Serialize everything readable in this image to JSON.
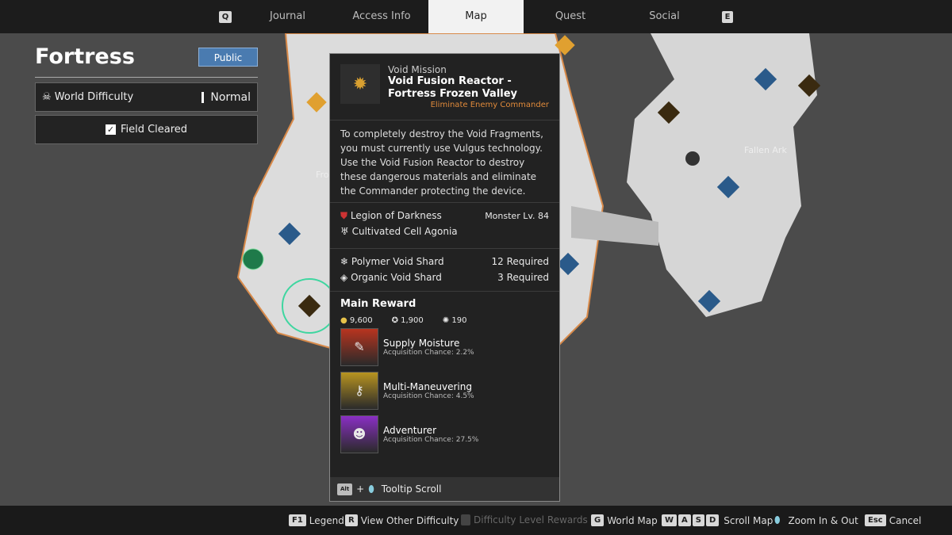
{
  "tabs": [
    {
      "key": "Q",
      "label": ""
    },
    {
      "label": "Journal"
    },
    {
      "label": "Access Info"
    },
    {
      "label": "Map",
      "active": true
    },
    {
      "label": "Quest"
    },
    {
      "label": "Social"
    },
    {
      "key": "E",
      "label": ""
    }
  ],
  "top_keys": {
    "left": "Q",
    "right": "E"
  },
  "page": {
    "title": "Fortress",
    "visibility": "Public"
  },
  "world_difficulty": {
    "label": "World Difficulty",
    "value": "Normal"
  },
  "field_cleared": {
    "label": "Field Cleared",
    "checked": true
  },
  "map_labels": {
    "fallen_ark": "Fallen Ark",
    "fro": "Fro"
  },
  "tooltip": {
    "category": "Void Mission",
    "title": "Void Fusion Reactor - Fortress Frozen Valley",
    "objective": "Eliminate Enemy Commander",
    "description": "To completely destroy the Void Fragments, you must currently use Vulgus technology. Use the Void Fusion Reactor to destroy these dangerous materials and eliminate the Commander protecting the device.",
    "faction": "Legion of Darkness",
    "monster_level": "Monster Lv. 84",
    "boss": "Cultivated Cell Agonia",
    "requirements": [
      {
        "name": "Polymer Void Shard",
        "count": "12 Required"
      },
      {
        "name": "Organic Void Shard",
        "count": "3 Required"
      }
    ],
    "main_reward_label": "Main Reward",
    "currencies": [
      {
        "icon": "gold-coin",
        "value": "9,600"
      },
      {
        "icon": "xp",
        "value": "1,900"
      },
      {
        "icon": "kuiper",
        "value": "190"
      }
    ],
    "rewards": [
      {
        "name": "Supply Moisture",
        "chance": "Acquisition Chance: 2.2%",
        "color": "#b8341f"
      },
      {
        "name": "Multi-Maneuvering",
        "chance": "Acquisition Chance: 4.5%",
        "color": "#b89420"
      },
      {
        "name": "Adventurer",
        "chance": "Acquisition Chance: 27.5%",
        "color": "#8a2fc4"
      }
    ],
    "scroll_hint": {
      "key": "Alt",
      "label": "Tooltip Scroll"
    }
  },
  "bottom": [
    {
      "key": "F1",
      "label": "Legend"
    },
    {
      "key": "R",
      "label": "View Other Difficulty"
    },
    {
      "key": "",
      "label": "Difficulty Level Rewards",
      "disabled": true
    },
    {
      "key": "G",
      "label": "World Map"
    },
    {
      "keys": [
        "W",
        "A",
        "S",
        "D"
      ],
      "label": "Scroll Map"
    },
    {
      "key": "",
      "label": "Zoom In & Out"
    },
    {
      "key": "Esc",
      "label": "Cancel"
    }
  ]
}
